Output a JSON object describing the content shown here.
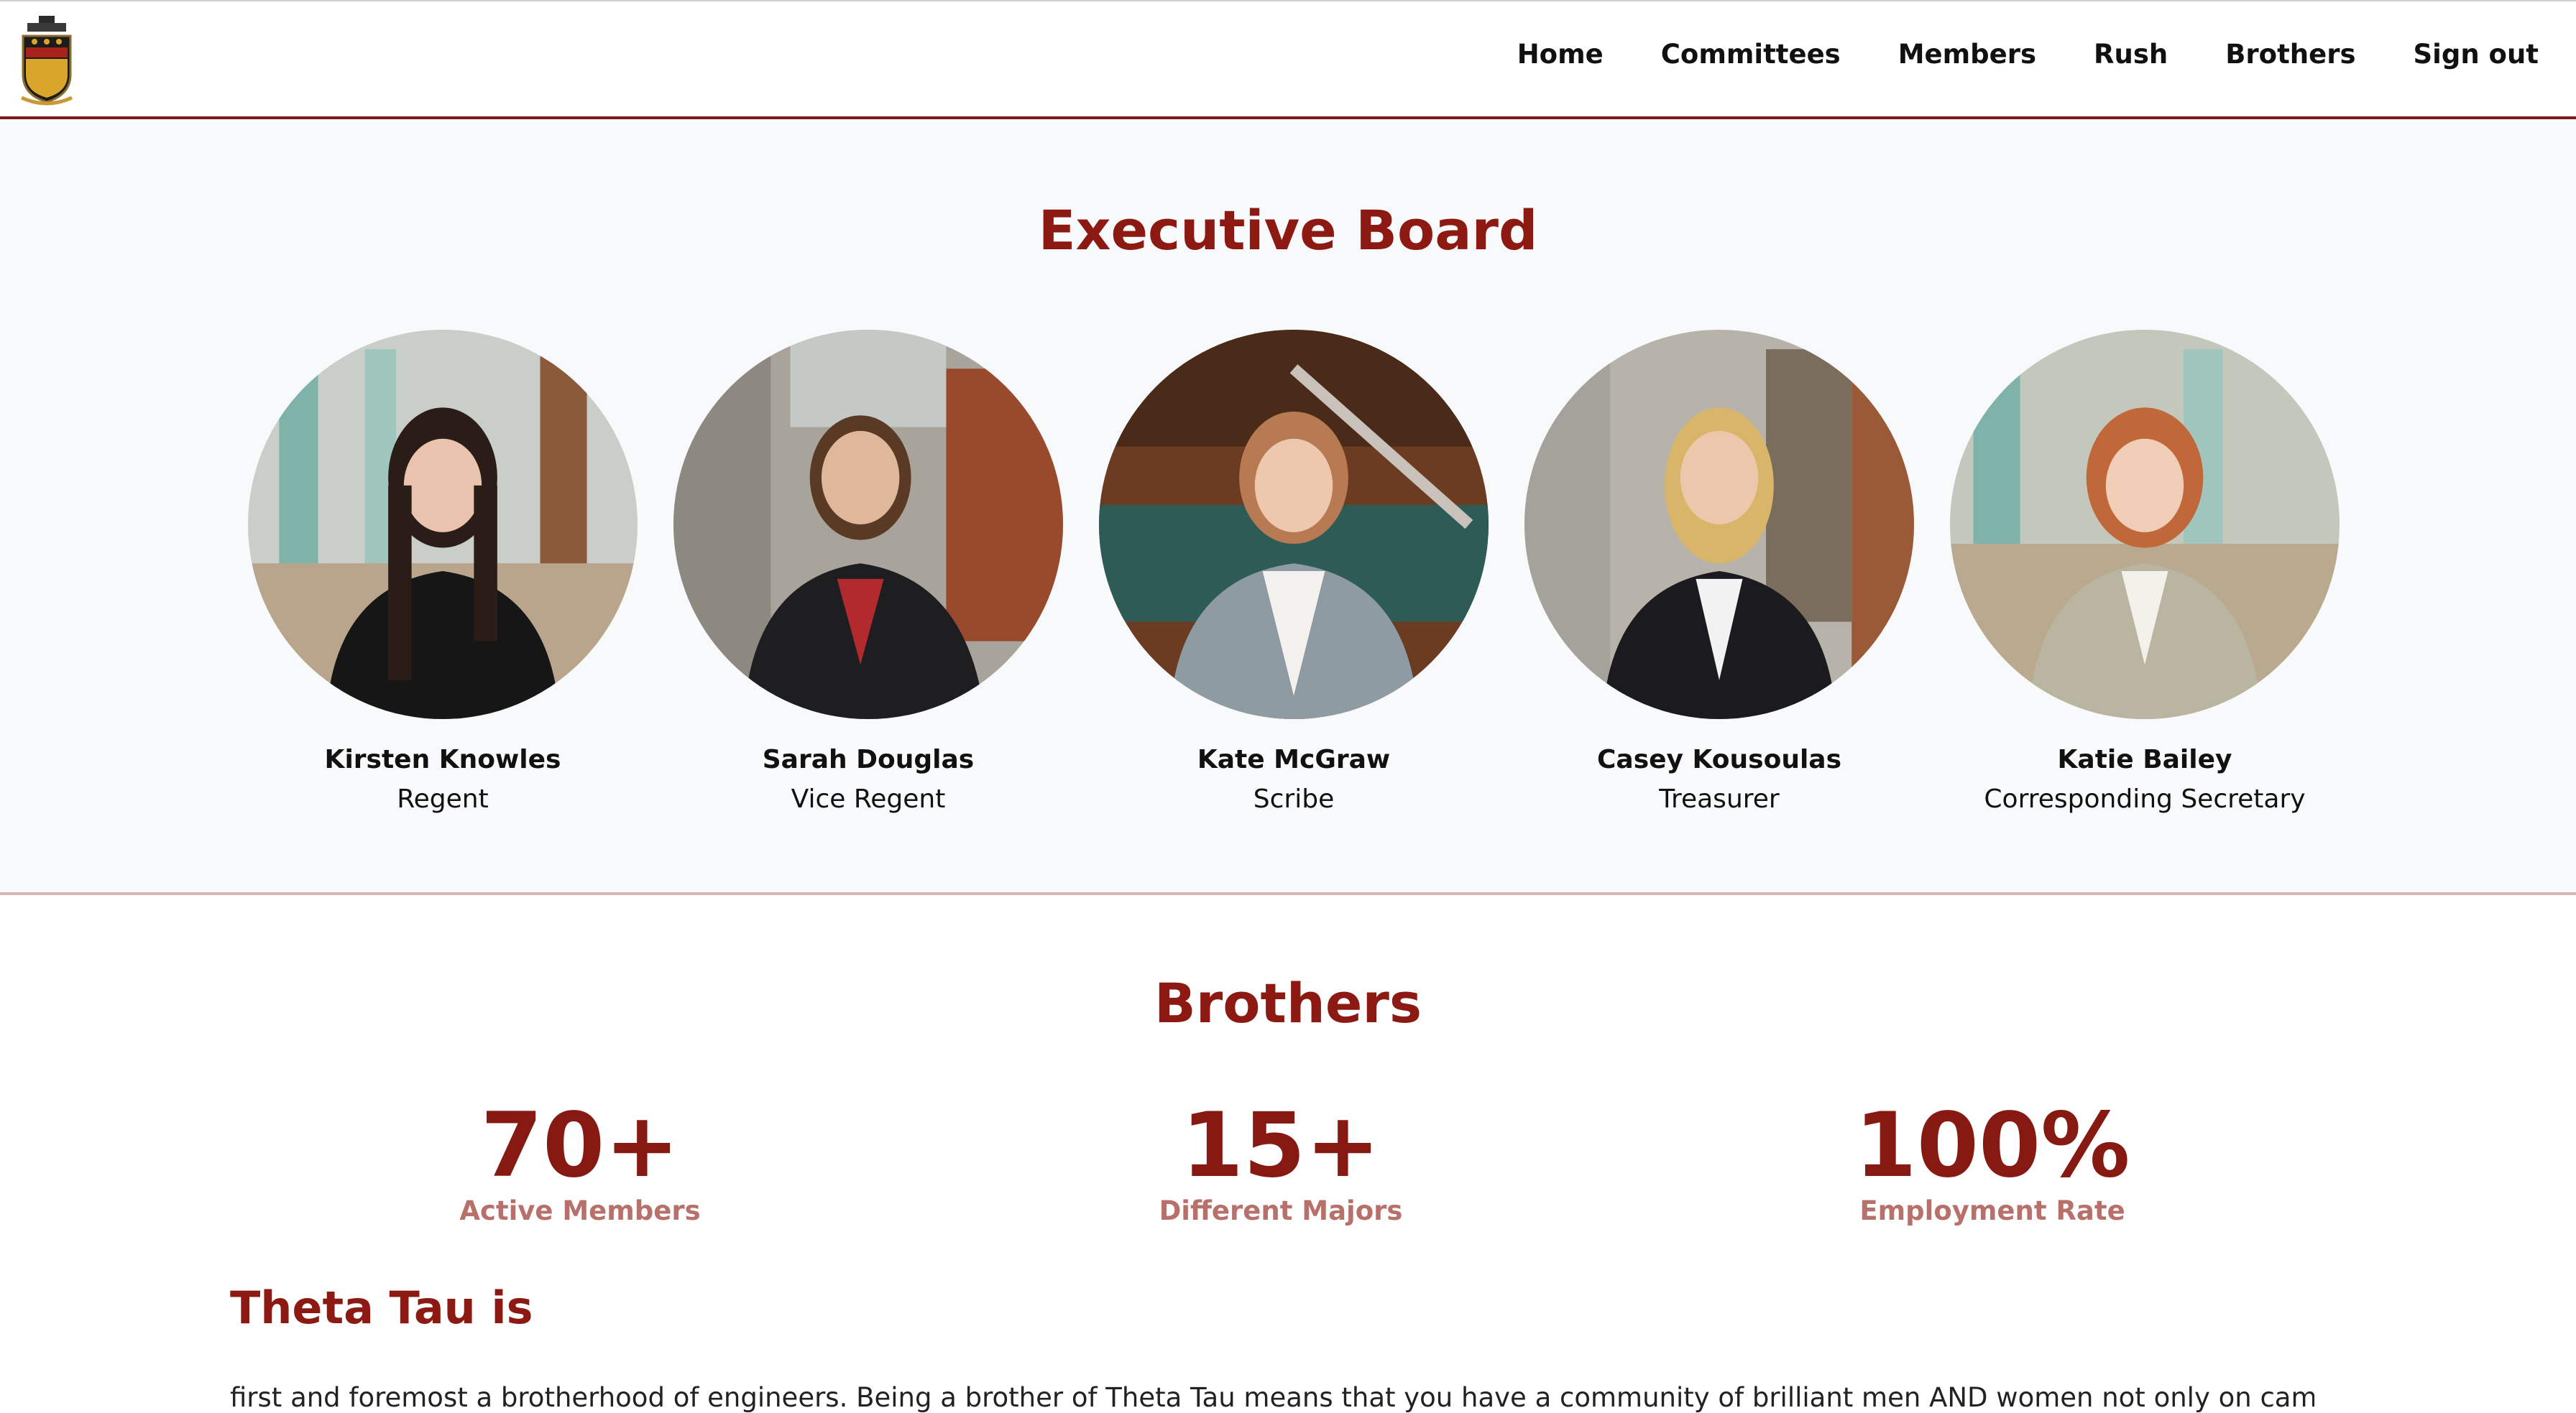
{
  "nav": {
    "logo": "crest-logo",
    "links": [
      "Home",
      "Committees",
      "Members",
      "Rush",
      "Brothers",
      "Sign out"
    ]
  },
  "exec": {
    "title": "Executive Board",
    "members": [
      {
        "name": "Kirsten Knowles",
        "role": "Regent"
      },
      {
        "name": "Sarah Douglas",
        "role": "Vice Regent"
      },
      {
        "name": "Kate McGraw",
        "role": "Scribe"
      },
      {
        "name": "Casey Kousoulas",
        "role": "Treasurer"
      },
      {
        "name": "Katie Bailey",
        "role": "Corresponding Secretary"
      }
    ]
  },
  "brothers": {
    "title": "Brothers",
    "stats": [
      {
        "value": "70+",
        "label": "Active Members"
      },
      {
        "value": "15+",
        "label": "Different Majors"
      },
      {
        "value": "100%",
        "label": "Employment Rate"
      }
    ]
  },
  "theta": {
    "heading": "Theta Tau is",
    "text": "first and foremost a brotherhood of engineers. Being a brother of Theta Tau means that you have a community of brilliant men AND women not only on campus"
  },
  "colors": {
    "accent": "#8c1a12",
    "stat_label": "#b8706a",
    "nav_border": "#7a1a14"
  }
}
